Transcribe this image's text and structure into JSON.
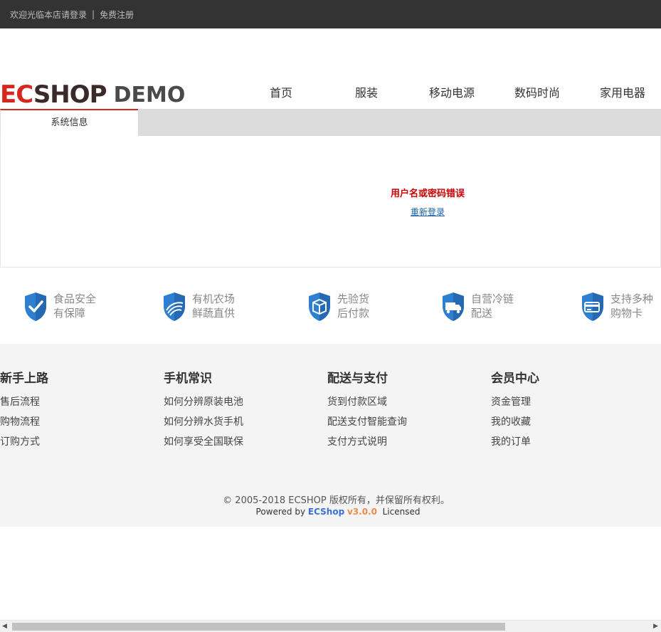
{
  "topbar": {
    "welcome": "欢迎光临本店请登录",
    "separator": "|",
    "register": "免费注册"
  },
  "logo": {
    "ec": "EC",
    "shop": "SHOP",
    "demo": "DEMO"
  },
  "nav": [
    "首页",
    "服装",
    "移动电源",
    "数码时尚",
    "家用电器"
  ],
  "tab": {
    "label": "系统信息"
  },
  "message": {
    "error": "用户名或密码错误",
    "relogin": "重新登录"
  },
  "services": [
    {
      "line1": "食品安全",
      "line2": "有保障",
      "icon": "check-shield-icon"
    },
    {
      "line1": "有机农场",
      "line2": "鲜蔬直供",
      "icon": "farm-shield-icon"
    },
    {
      "line1": "先验货",
      "line2": "后付款",
      "icon": "box-shield-icon"
    },
    {
      "line1": "自营冷链",
      "line2": "配送",
      "icon": "truck-shield-icon"
    },
    {
      "line1": "支持多种",
      "line2": "购物卡",
      "icon": "card-shield-icon"
    }
  ],
  "footer": {
    "columns": [
      {
        "title": "新手上路",
        "links": [
          "售后流程",
          "购物流程",
          "订购方式"
        ]
      },
      {
        "title": "手机常识",
        "links": [
          "如何分辨原装电池",
          "如何分辨水货手机",
          "如何享受全国联保"
        ]
      },
      {
        "title": "配送与支付",
        "links": [
          "货到付款区域",
          "配送支付智能查询",
          "支付方式说明"
        ]
      },
      {
        "title": "会员中心",
        "links": [
          "资金管理",
          "我的收藏",
          "我的订单"
        ]
      }
    ],
    "copyright": "© 2005-2018 ECSHOP 版权所有，并保留所有权利。",
    "powered_prefix": "Powered by",
    "powered_brand": "ECShop",
    "powered_version": "v3.0.0",
    "powered_suffix": "Licensed"
  },
  "colors": {
    "accent": "#d7261d",
    "topbar_bg": "#333333",
    "link": "#1a5fa8",
    "icon_blue": "#2f7fd0"
  }
}
